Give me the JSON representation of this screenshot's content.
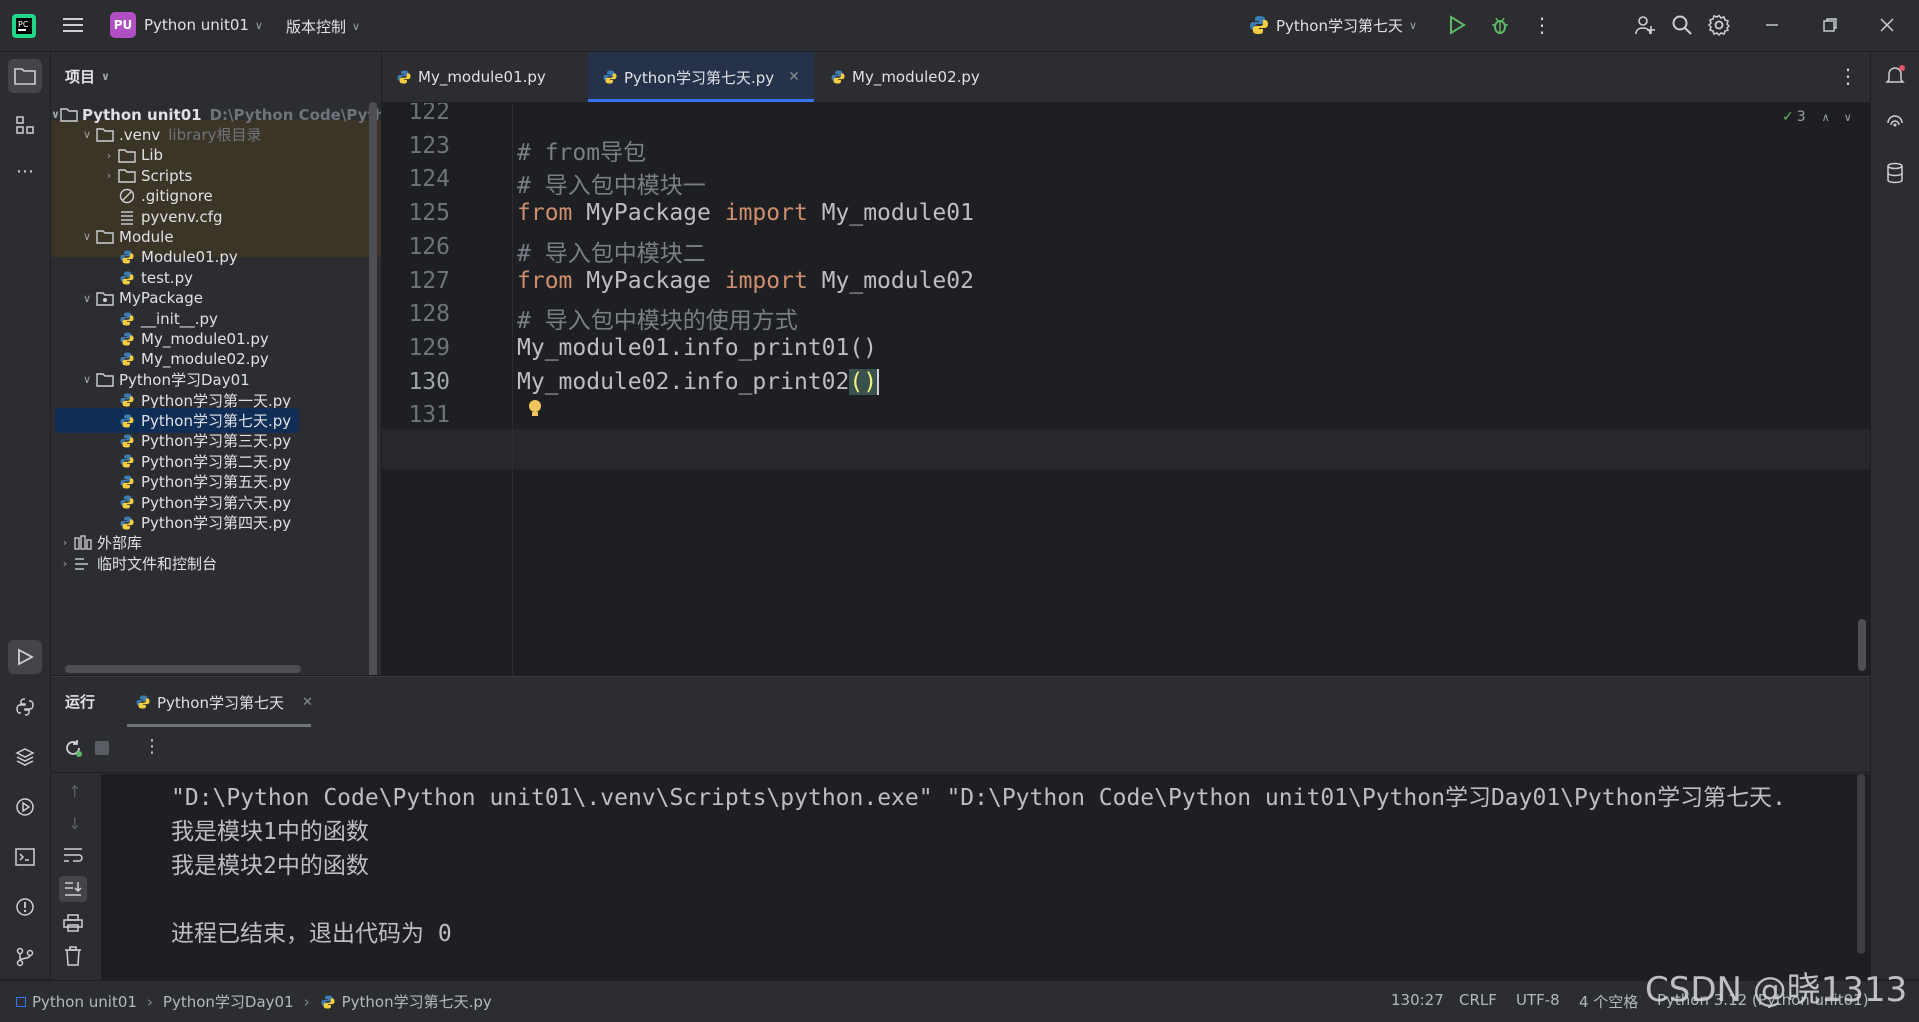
{
  "titlebar": {
    "project_badge": "PU",
    "project_name": "Python unit01",
    "vcs_label": "版本控制",
    "run_config": "Python学习第七天"
  },
  "project_panel": {
    "title": "项目",
    "tree": [
      {
        "label": "Python unit01",
        "hint": "D:\\Python Code\\Pytho",
        "icon": "folder-icon",
        "expanded": true
      },
      {
        "label": ".venv",
        "hint": "library根目录",
        "icon": "folder-icon",
        "expanded": true
      },
      {
        "label": "Lib",
        "icon": "folder-icon",
        "expanded": false
      },
      {
        "label": "Scripts",
        "icon": "folder-icon",
        "expanded": false
      },
      {
        "label": ".gitignore",
        "icon": "ignore-file-icon"
      },
      {
        "label": "pyvenv.cfg",
        "icon": "config-file-icon"
      },
      {
        "label": "Module",
        "icon": "folder-icon",
        "expanded": true
      },
      {
        "label": "Module01.py",
        "icon": "python-file-icon"
      },
      {
        "label": "test.py",
        "icon": "python-file-icon"
      },
      {
        "label": "MyPackage",
        "icon": "package-folder-icon",
        "expanded": true
      },
      {
        "label": "__init__.py",
        "icon": "python-file-icon"
      },
      {
        "label": "My_module01.py",
        "icon": "python-file-icon"
      },
      {
        "label": "My_module02.py",
        "icon": "python-file-icon"
      },
      {
        "label": "Python学习Day01",
        "icon": "folder-icon",
        "expanded": true
      },
      {
        "label": "Python学习第一天.py",
        "icon": "python-file-icon"
      },
      {
        "label": "Python学习第七天.py",
        "icon": "python-file-icon",
        "selected": true
      },
      {
        "label": "Python学习第三天.py",
        "icon": "python-file-icon"
      },
      {
        "label": "Python学习第二天.py",
        "icon": "python-file-icon"
      },
      {
        "label": "Python学习第五天.py",
        "icon": "python-file-icon"
      },
      {
        "label": "Python学习第六天.py",
        "icon": "python-file-icon"
      },
      {
        "label": "Python学习第四天.py",
        "icon": "python-file-icon"
      },
      {
        "label": "外部库",
        "icon": "library-icon",
        "expanded": false
      },
      {
        "label": "临时文件和控制台",
        "icon": "scratch-icon",
        "expanded": false
      }
    ]
  },
  "editor": {
    "tabs": [
      {
        "label": "My_module01.py",
        "active": false
      },
      {
        "label": "Python学习第七天.py",
        "active": true
      },
      {
        "label": "My_module02.py",
        "active": false
      }
    ],
    "inspection_count": "3",
    "lines": [
      {
        "num": "122",
        "text": ""
      },
      {
        "num": "123",
        "text": "# from导包"
      },
      {
        "num": "124",
        "text": "# 导入包中模块一"
      },
      {
        "num": "125",
        "text": "from MyPackage import My_module01"
      },
      {
        "num": "126",
        "text": "# 导入包中模块二"
      },
      {
        "num": "127",
        "text": "from MyPackage import My_module02"
      },
      {
        "num": "128",
        "text": "# 导入包中模块的使用方式"
      },
      {
        "num": "129",
        "text": "My_module01.info_print01()"
      },
      {
        "num": "130",
        "text": "My_module02.info_print02()"
      },
      {
        "num": "131",
        "text": ""
      }
    ],
    "current_line": "130"
  },
  "run_panel": {
    "title": "运行",
    "tab_label": "Python学习第七天",
    "console": [
      "\"D:\\Python Code\\Python unit01\\.venv\\Scripts\\python.exe\" \"D:\\Python Code\\Python unit01\\Python学习Day01\\Python学习第七天.",
      "我是模块1中的函数",
      "我是模块2中的函数",
      "",
      "进程已结束，退出代码为 0"
    ]
  },
  "statusbar": {
    "breadcrumb": [
      "Python unit01",
      "Python学习Day01",
      "Python学习第七天.py"
    ],
    "position": "130:27",
    "line_sep": "CRLF",
    "encoding": "UTF-8",
    "indent": "4 个空格",
    "interpreter": "Python 3.12 (Python unit01)"
  },
  "watermark": "CSDN @晓1313",
  "colors": {
    "accent": "#3574f0",
    "keyword": "#cf8e6d",
    "comment": "#7a7e85",
    "run_green": "#5fb865",
    "background": "#1e1f22"
  }
}
